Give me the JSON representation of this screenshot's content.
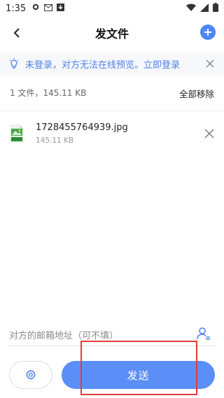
{
  "status_bar": {
    "time": "1:35",
    "icons": [
      "gear-icon",
      "gmail-icon",
      "download-box-icon"
    ],
    "right_icons": [
      "wifi-icon",
      "signal-icon",
      "battery-icon"
    ]
  },
  "app_bar": {
    "title": "发文件",
    "back_icon": "back-arrow-icon",
    "add_icon": "plus-circle-icon"
  },
  "notice": {
    "text": "未登录，对方无法在线预览。立即登录",
    "icon": "lightbulb-icon"
  },
  "summary": {
    "text": "1 文件，145.11 KB",
    "remove_all": "全部移除"
  },
  "files": [
    {
      "name": "1728455764939.jpg",
      "size": "145.11 KB",
      "icon": "jpeg-file-icon"
    }
  ],
  "recipient": {
    "placeholder": "对方的邮箱地址（可不填）",
    "icon": "contact-icon"
  },
  "actions": {
    "settings_icon": "settings-icon",
    "send_label": "发送"
  },
  "colors": {
    "accent": "#5b8ef7",
    "notice_text": "#4d7fe8",
    "highlight": "#e23c3c"
  }
}
